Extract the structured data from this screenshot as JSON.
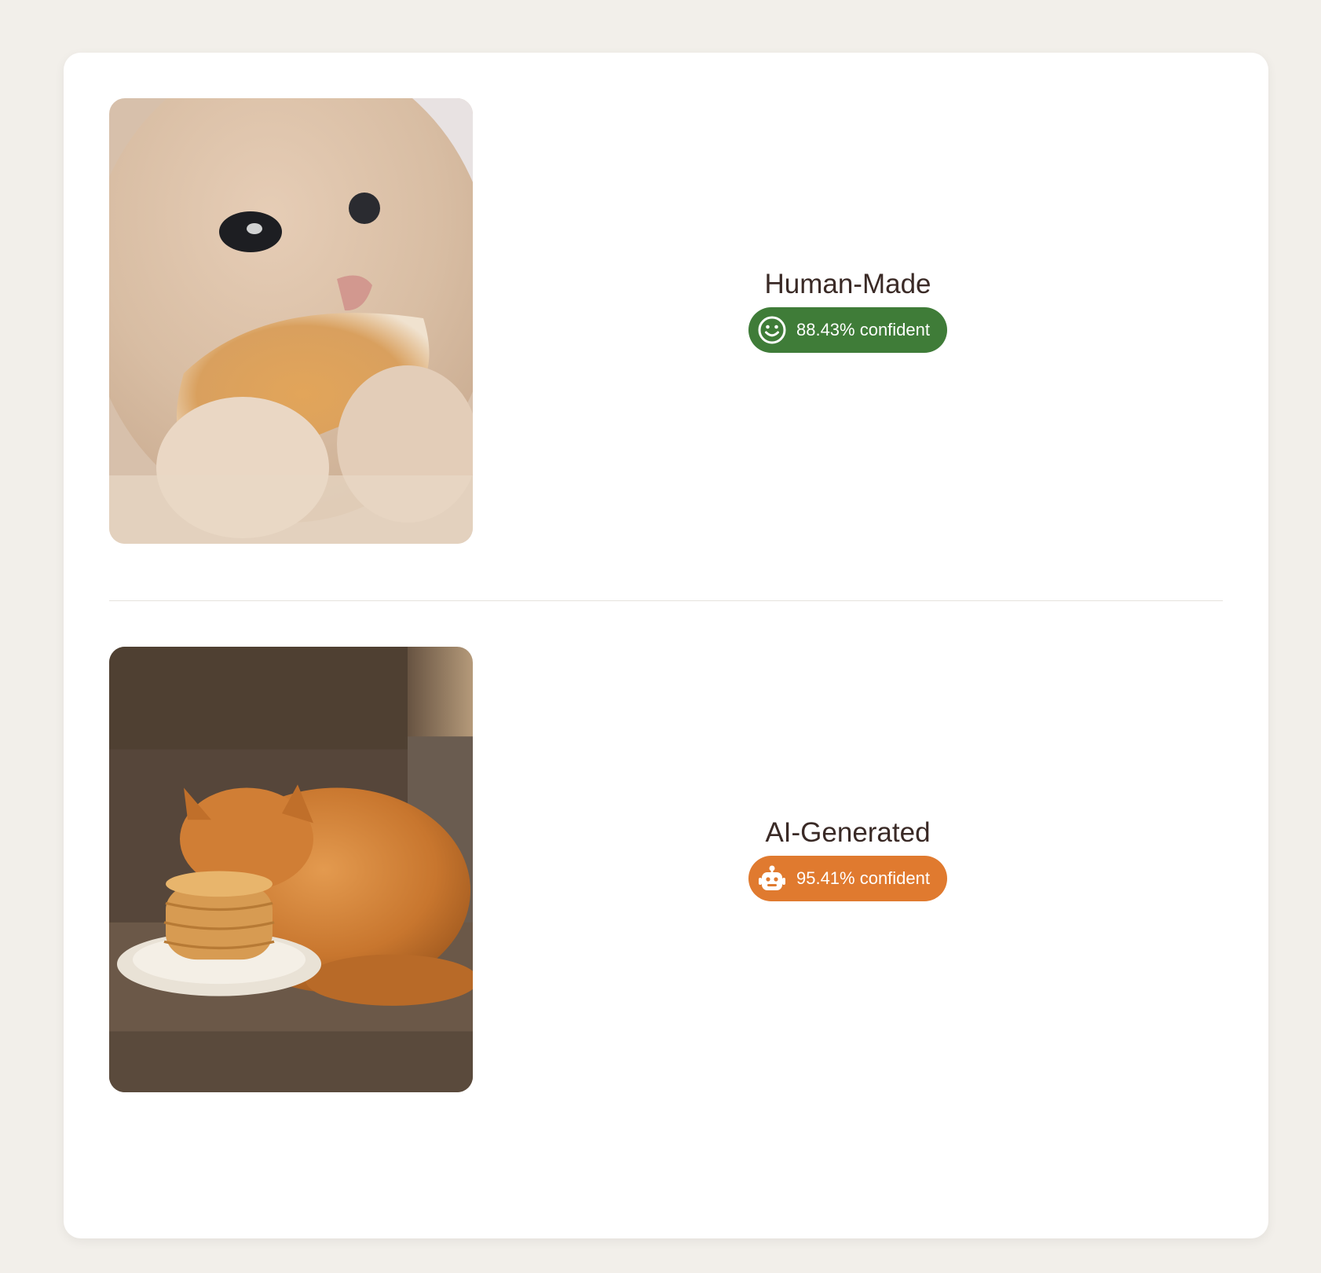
{
  "colors": {
    "page_background": "#f2efea",
    "card_background": "#ffffff",
    "human_badge": "#3f7c38",
    "ai_badge": "#e07a2f",
    "title_text": "#3a2a26"
  },
  "results": [
    {
      "verdict": "Human-Made",
      "confidence_label": "88.43% confident",
      "confidence": 0.8843,
      "icon": "smiley-face-icon",
      "image": "photo of cream cat eating a pancake"
    },
    {
      "verdict": "AI-Generated",
      "confidence_label": "95.41% confident",
      "confidence": 0.9541,
      "icon": "robot-icon",
      "image": "image of orange cat on a sofa beside a stack of pancakes"
    }
  ]
}
